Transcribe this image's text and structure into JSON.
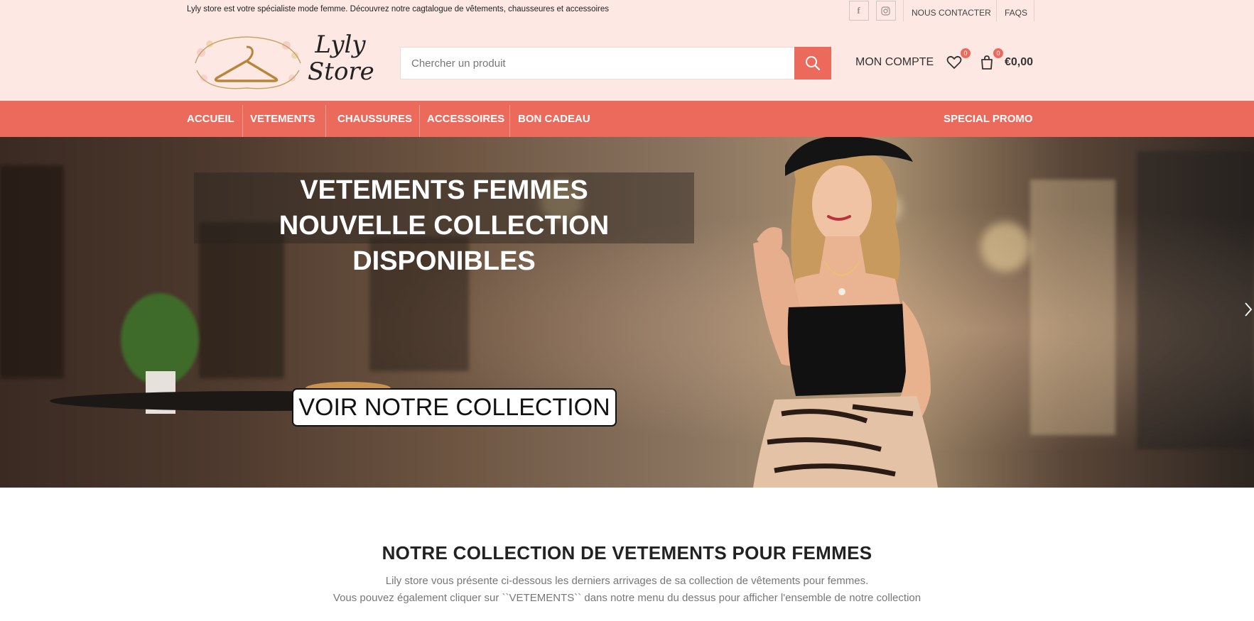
{
  "topbar": {
    "promo_text": "Lyly store est votre spécialiste mode femme. Découvrez notre cagtalogue de vêtements, chausseures et accessoires",
    "social": [
      {
        "icon": "facebook-icon",
        "glyph": "f"
      },
      {
        "icon": "instagram-icon",
        "glyph": "◎"
      }
    ],
    "links": [
      "NOUS CONTACTER",
      "FAQS"
    ]
  },
  "header": {
    "logo_text": "Lyly Store",
    "search_placeholder": "Chercher un produit",
    "account_label": "MON COMPTE",
    "wishlist_count": "0",
    "cart_count": "0",
    "cart_total": "€0,00"
  },
  "nav": {
    "items": [
      "ACCUEIL",
      "VETEMENTS",
      "CHAUSSURES",
      "ACCESSOIRES",
      "BON CADEAU"
    ],
    "promo": "SPECIAL PROMO"
  },
  "hero": {
    "title_line1": "VETEMENTS FEMMES",
    "title_line2": "NOUVELLE COLLECTION DISPONIBLES",
    "cta": "VOIR NOTRE COLLECTION"
  },
  "collection": {
    "title": "NOTRE COLLECTION DE VETEMENTS POUR FEMMES",
    "desc_line1": "Lily store vous présente ci-dessous les derniers arrivages de sa collection de vêtements pour femmes.",
    "desc_line2": "Vous pouvez également cliquer sur ``VETEMENTS`` dans notre menu du dessus pour afficher l'ensemble de notre collection"
  },
  "colors": {
    "accent": "#ec6a5c",
    "header_bg": "#fde8e3"
  }
}
